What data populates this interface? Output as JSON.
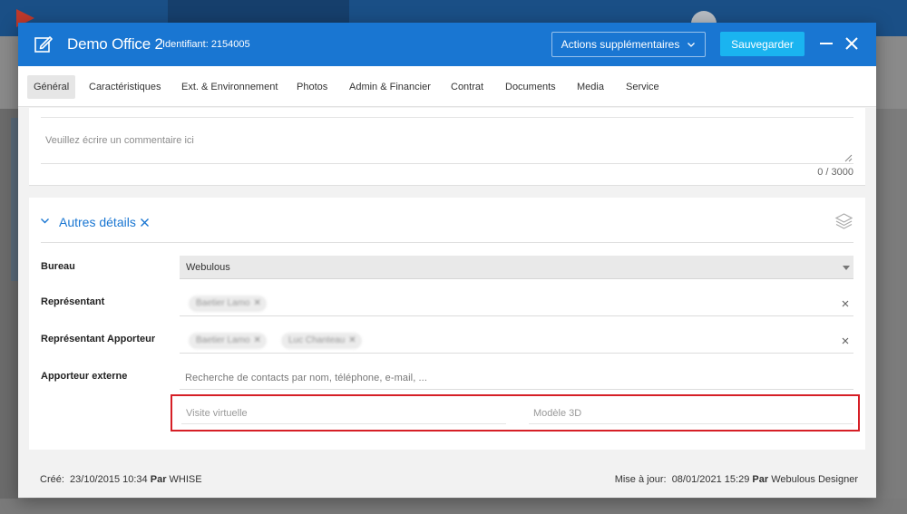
{
  "modal": {
    "title": "Demo Office 2",
    "identifier": "Identifiant: 2154005",
    "actions_label": "Actions supplémentaires",
    "save_label": "Sauvegarder"
  },
  "tabs": [
    {
      "label": "Général",
      "active": true
    },
    {
      "label": "Caractéristiques"
    },
    {
      "label": "Ext. & Environnement"
    },
    {
      "label": "Photos"
    },
    {
      "label": "Admin & Financier"
    },
    {
      "label": "Contrat"
    },
    {
      "label": "Documents"
    },
    {
      "label": "Media"
    },
    {
      "label": "Service"
    }
  ],
  "comment": {
    "placeholder": "Veuillez écrire un commentaire ici",
    "counter": "0 / 3000"
  },
  "details": {
    "title": "Autres détails",
    "bureau": {
      "label": "Bureau",
      "value": "Webulous"
    },
    "representant": {
      "label": "Représentant",
      "chips": [
        "Baetier Lamo"
      ]
    },
    "representant_apporteur": {
      "label": "Représentant Apporteur",
      "chips": [
        "Baetier Lamo",
        "Luc Chanteau"
      ]
    },
    "apporteur_externe": {
      "label": "Apporteur externe",
      "placeholder": "Recherche de contacts par nom, téléphone, e-mail, ..."
    },
    "visite_virtuelle": {
      "placeholder": "Visite virtuelle"
    },
    "modele_3d": {
      "placeholder": "Modèle 3D"
    }
  },
  "footer": {
    "created_label": "Créé:",
    "created_date": "23/10/2015 10:34",
    "created_by_label": "Par",
    "created_by": "WHISE",
    "updated_label": "Mise à jour:",
    "updated_date": "08/01/2021 15:29",
    "updated_by_label": "Par",
    "updated_by": "Webulous Designer"
  },
  "colors": {
    "header": "#1976d2",
    "save": "#1ab4f0",
    "highlight": "#d61f26"
  }
}
